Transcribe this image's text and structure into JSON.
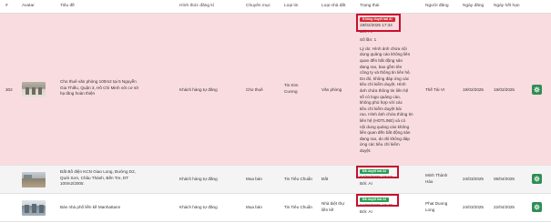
{
  "columns": [
    "#",
    "Avatar",
    "Tiêu đề",
    "Hình thức đăng kí",
    "Chuyên mục",
    "Loại tin",
    "Loại nhà đất",
    "Trạng thái",
    "Người đăng",
    "Ngày đăng",
    "Ngày hết hạn"
  ],
  "rows": [
    {
      "index": "302",
      "title_lines": [
        "Cho thuê văn phòng 100m2 tại 5 Nguyễn",
        "Gia Thiều, Quận 3, Hồ Chí Minh với cơ sở",
        "hạ tầng hoàn thiện"
      ],
      "registration": "Khách hàng tự đăng",
      "category": "Cho thuê",
      "listing_type_lines": [
        "Tin Kim",
        "Cương"
      ],
      "property_type": "Văn phòng",
      "status_badge": "Không duyệt bài AI",
      "status_time": "19/02/2025 17:34",
      "status_by": "Bởi: AI",
      "status_count": "Số lần: 1",
      "status_reason": [
        "Lý do: Hình ảnh chứa nội",
        "dung quảng cáo không liên",
        "quan đến bất động sản",
        "đang rao, bao gồm tên",
        "công ty và thông tin liên hệ.",
        "Do đó, không đáp ứng các",
        "tiêu chí kiểm duyệt. Hình",
        "ảnh chứa thông tin liên hệ",
        "số có logo quảng cáo,",
        "không phù hợp với các",
        "tiêu chí kiểm duyệt bài",
        "rao. Hình ảnh chứa thông tin",
        "liên hệ (HOTLINE) và có",
        "nội dung quảng cáo không",
        "liên quan đến bất động sản",
        "đang rao, do đó không đáp",
        "ứng các tiêu chí kiểm",
        "duyệt."
      ],
      "poster": "Thế Tài VI",
      "posted": "19/02/2025",
      "expires": "19/02/2025"
    },
    {
      "index": "",
      "title_lines": [
        "Đất Bồ điện KCN Giao Long, Đường D2,",
        "Quới Sơn, Châu Thành, Bến Tre, DT",
        "100m2/200tr."
      ],
      "registration": "Khách hàng tự đăng",
      "category": "Mua bán",
      "listing_type_lines": [
        "Tin Tiêu Chuẩn"
      ],
      "property_type": "Đất",
      "status_badge": "Đã duyệt bài AI",
      "status_time": "24/03/2025 10:10",
      "status_by": "Bởi: AI",
      "poster_lines": [
        "Minh Thành",
        "Hào"
      ],
      "posted": "24/03/2025",
      "expires": "06/04/2025"
    },
    {
      "index": "",
      "title_lines": [
        "Bán nhà phố liền kề Manhattann"
      ],
      "registration": "Khách hàng tự đăng",
      "category": "Mua bán",
      "listing_type_lines": [
        "Tin Tiêu Chuẩn"
      ],
      "property_type_lines": [
        "Nhà biệt thự",
        "liền kề"
      ],
      "status_badge": "Đã duyệt bài AI",
      "status_time": "24/03/2025 10:40",
      "status_by": "Bởi: AI",
      "poster_lines": [
        "Phat Duong",
        "Long"
      ],
      "posted": "24/03/2025",
      "expires": "22/04/2025"
    }
  ],
  "colors": {
    "rejected_row": "#f9dcdf",
    "reject_badge": "#d9272e",
    "approve_badge": "#2e9d55",
    "highlight": "#c8102e",
    "action_button": "#2f8e55"
  },
  "icons": {
    "action": "settings-icon"
  }
}
